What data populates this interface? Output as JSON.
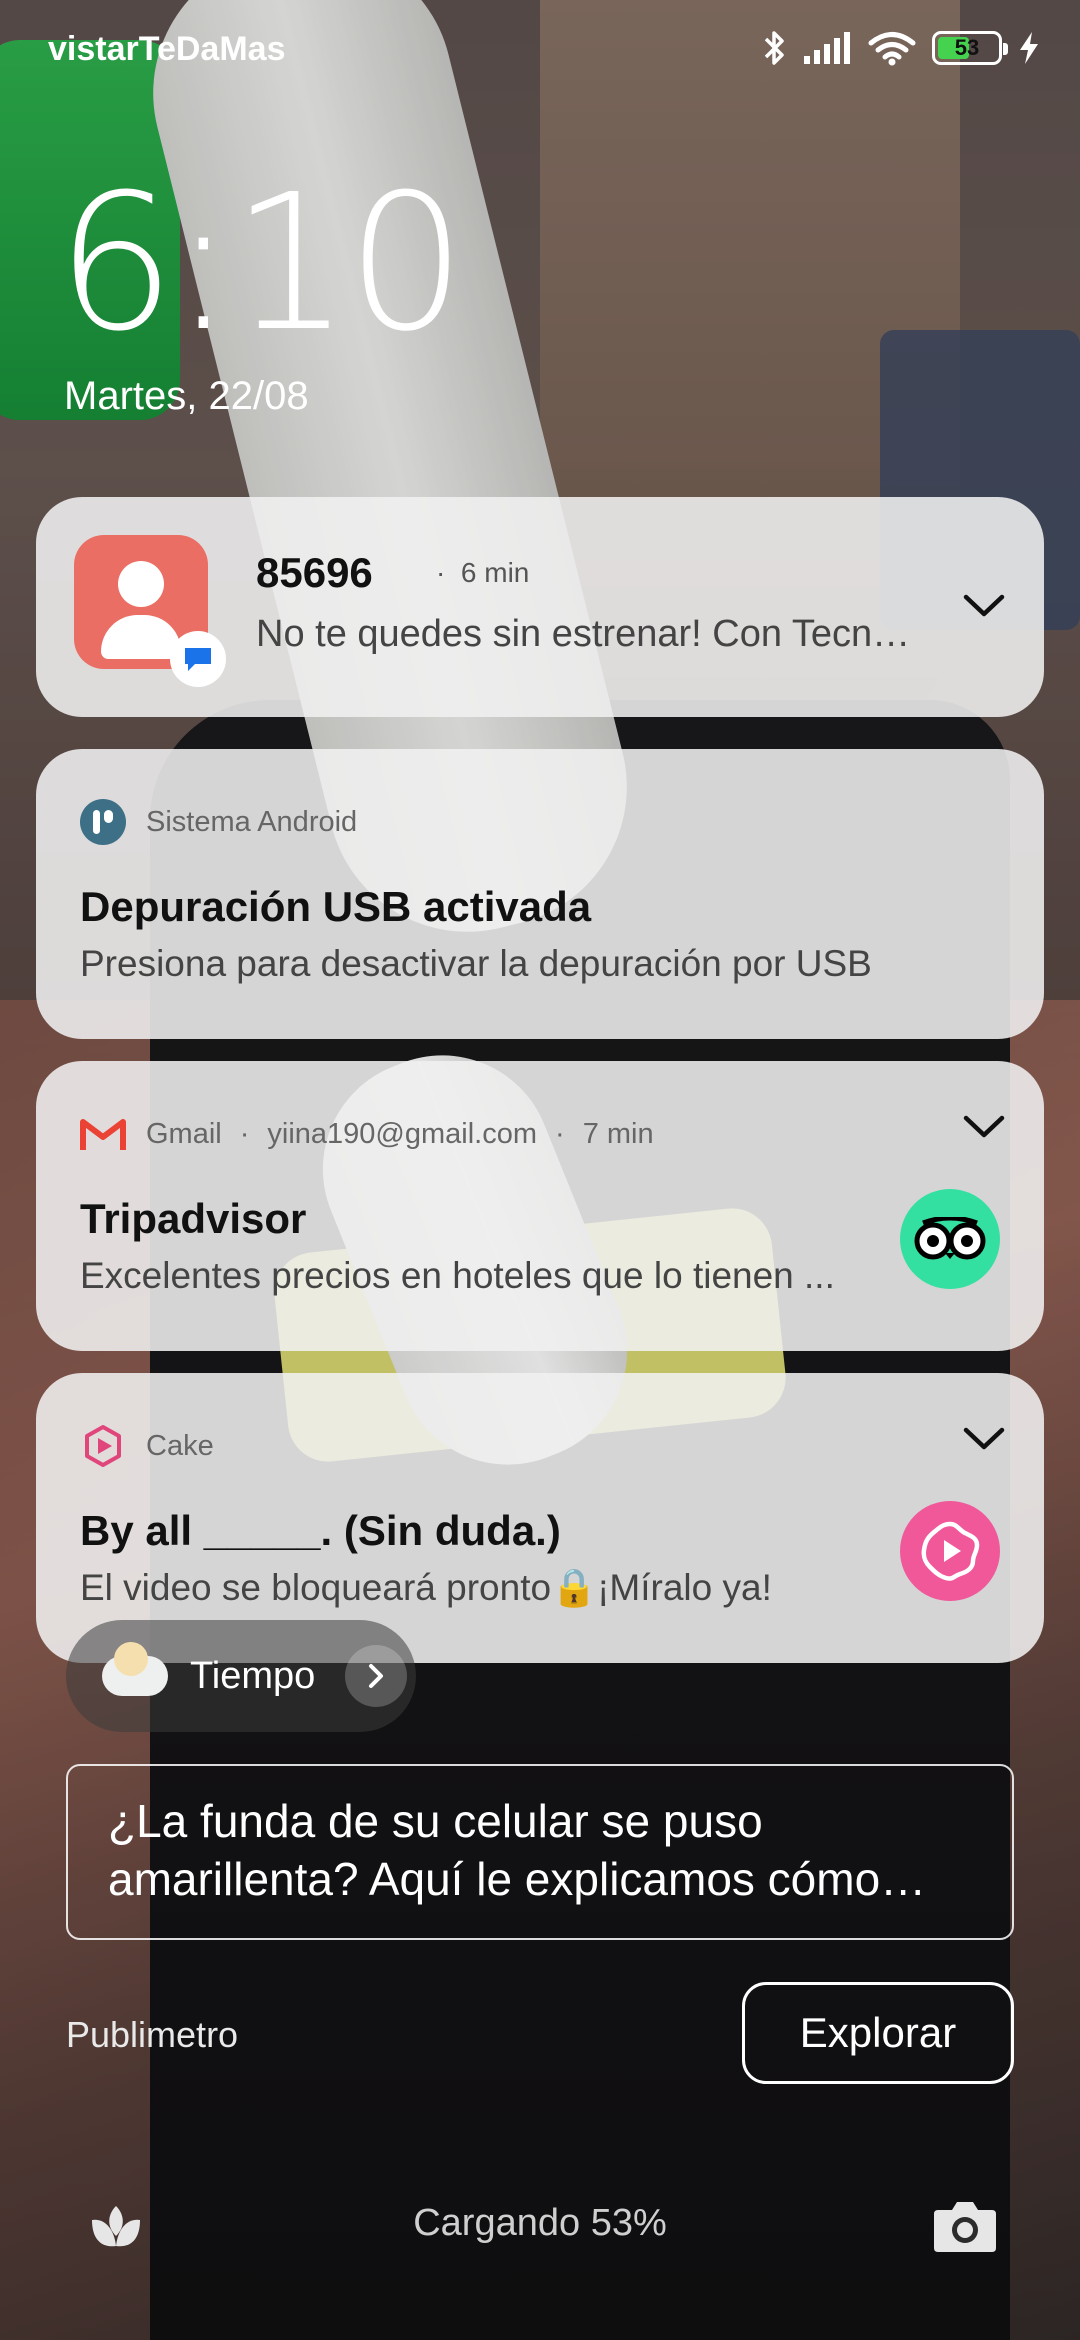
{
  "status_bar": {
    "carrier": "vistarTeDaMas",
    "battery_level": "53",
    "battery_percent": 53
  },
  "lockscreen": {
    "time": "6:10",
    "date": "Martes, 22/08"
  },
  "notifications": [
    {
      "sender": "85696",
      "time": "6 min",
      "body": "No te quedes sin estrenar! Con Tecnoshop..."
    },
    {
      "app": "Sistema Android",
      "title": "Depuración USB activada",
      "body": "Presiona para desactivar la depuración por USB"
    },
    {
      "app": "Gmail",
      "account": "yiina190@gmail.com",
      "time": "7 min",
      "title": "Tripadvisor",
      "body": "Excelentes precios en hoteles que lo tienen ..."
    },
    {
      "app": "Cake",
      "title": "By all _____. (Sin duda.)",
      "body": "El video se bloqueará pronto🔒¡Míralo ya!"
    }
  ],
  "weather": {
    "label": "Tiempo"
  },
  "news": {
    "headline": "¿La funda de su celular se puso amarillenta? Aquí le explicamos cómo limpiarla",
    "source": "Publimetro",
    "explore_label": "Explorar"
  },
  "bottom_bar": {
    "charging_text": "Cargando 53%"
  },
  "colors": {
    "card_background": "#f0f0f0",
    "contact_avatar": "#ea6e63",
    "gmail_red": "#ea4335",
    "tripadvisor_green": "#34e0a1",
    "cake_pink": "#f0589a",
    "battery_fill": "#45d34f"
  },
  "icons": {
    "status": [
      "bluetooth-icon",
      "signal-icon",
      "wifi-icon",
      "battery-icon",
      "charging-bolt-icon"
    ],
    "bottom": [
      "flower-shortcut-icon",
      "camera-icon"
    ]
  }
}
